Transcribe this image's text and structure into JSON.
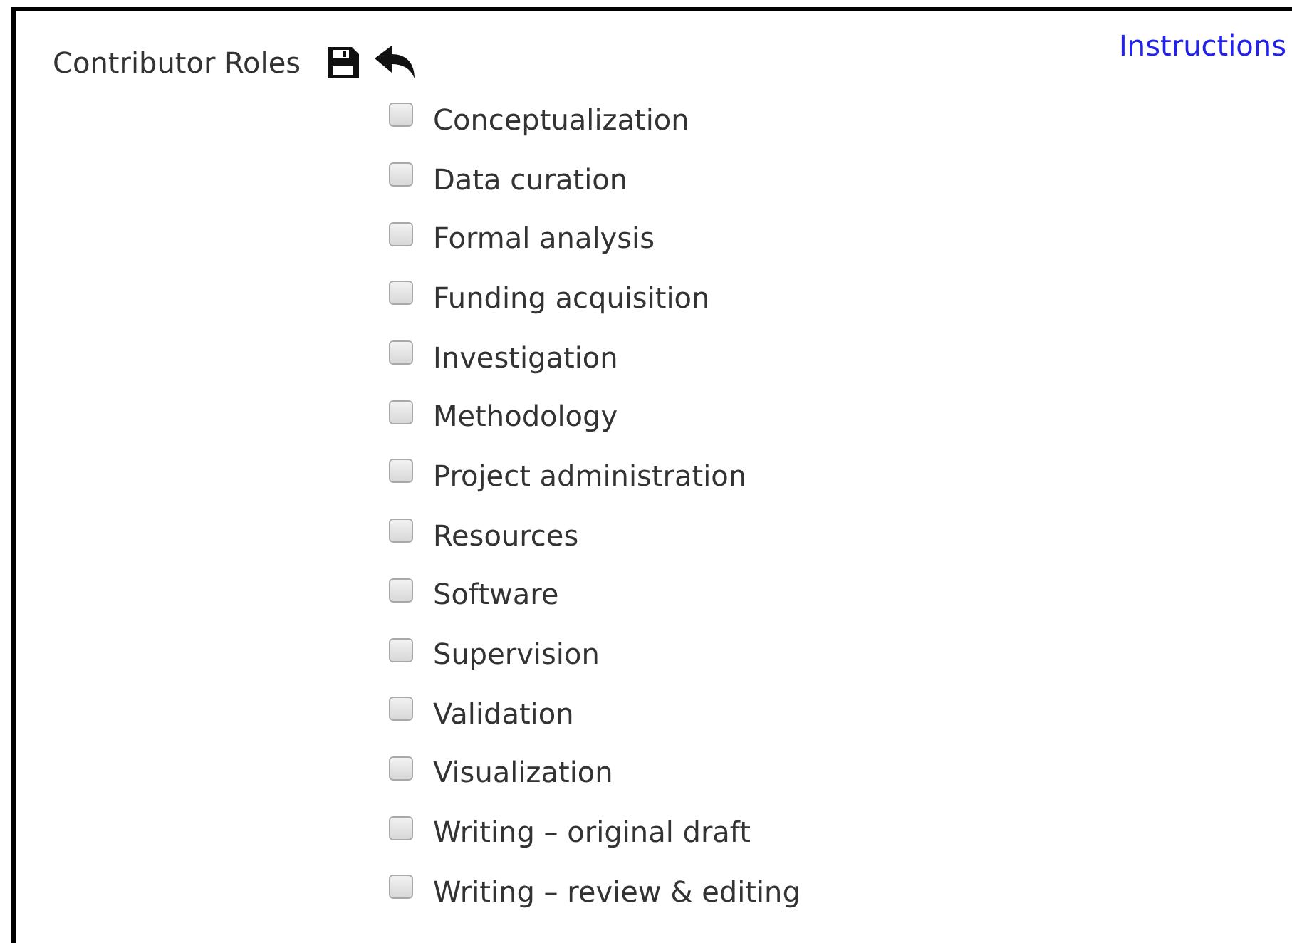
{
  "header": {
    "title": "Contributor Roles",
    "link": "Instructions"
  },
  "roles": [
    {
      "label": "Conceptualization",
      "checked": false
    },
    {
      "label": "Data curation",
      "checked": false
    },
    {
      "label": "Formal analysis",
      "checked": false
    },
    {
      "label": "Funding acquisition",
      "checked": false
    },
    {
      "label": "Investigation",
      "checked": false
    },
    {
      "label": "Methodology",
      "checked": false
    },
    {
      "label": "Project administration",
      "checked": false
    },
    {
      "label": "Resources",
      "checked": false
    },
    {
      "label": "Software",
      "checked": false
    },
    {
      "label": "Supervision",
      "checked": false
    },
    {
      "label": "Validation",
      "checked": false
    },
    {
      "label": "Visualization",
      "checked": false
    },
    {
      "label": "Writing – original draft",
      "checked": false
    },
    {
      "label": "Writing – review & editing",
      "checked": false
    }
  ]
}
